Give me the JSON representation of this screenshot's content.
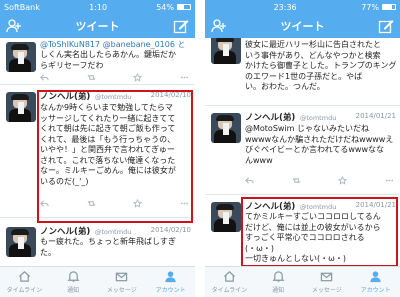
{
  "left": {
    "status": {
      "carrier": "SoftBank",
      "time": "1:10",
      "battery": "54%",
      "battery_fraction": 0.54
    },
    "nav_title": "ツイート",
    "tweets": [
      {
        "reply_line": "@ToShIKuN817 @banebane_0106 と",
        "lines": [
          "しくん実名出したらあかん。鍵垢だか",
          "らギリセーフだわ"
        ]
      },
      {
        "name": "ノンヘル(弟)",
        "handle": "@tomtmdu",
        "date": "2014/02/10",
        "lines": [
          "なんか9時くらいまで勉強してたらマ",
          "ッサージしてくれたり一緒に起きてて",
          "くれて朝は先に起きて朝ご飯も作って",
          "くれて、最後は「もう行っちゃうの、",
          "いやや！」と関西弁で言われてぎゅー",
          "されて。これで落ちない俺達くなった",
          "なー。ミルキーごめん。俺には彼女が",
          "いるのだ(_'_)"
        ]
      },
      {
        "name": "ノンヘル(弟)",
        "handle": "@tomtmdu",
        "date": "2014/02/10",
        "lines": [
          "もー疲れた。ちょっと新年飛ばしすぎ",
          "た。"
        ]
      }
    ],
    "tabs": [
      "タイムライン",
      "通知",
      "メッセージ",
      "アカウント"
    ]
  },
  "right": {
    "status": {
      "carrier": "",
      "time": "23:36",
      "battery": "77%",
      "battery_fraction": 0.77
    },
    "nav_title": "ツイート",
    "tweets": [
      {
        "lines": [
          "彼女に最近ハリー杉山に告白されたと",
          "いう事件があり、どんなやつかと検索",
          "かけたら御曹子とした。トランプのキング",
          "のエワード1世の子孫だと。やば",
          "い。おわた。つんだ。"
        ]
      },
      {
        "name": "ノンヘル(弟)",
        "handle": "@tomtmdu",
        "date": "2014/01/21",
        "lines": [
          "@MotoSwim じゃないみたいだね",
          "wwwwなんか騙されただけだねwwwwえ",
          "びぐベイビーとか言われてるwwwなな",
          "んwww"
        ]
      },
      {
        "name": "ノンヘル(弟)",
        "handle": "@tomtmdu",
        "date": "2014/01/21",
        "lines": [
          "てかミルキーすごいココロロしてるん",
          "だけど、俺には並上の彼女がいるから",
          "すっごく平常心でココロロされる",
          "(・ω・)",
          "一切きゅんとしない(・ω・)"
        ]
      }
    ],
    "tabs": [
      "タイムライン",
      "通知",
      "メッセージ",
      "アカウント"
    ]
  }
}
